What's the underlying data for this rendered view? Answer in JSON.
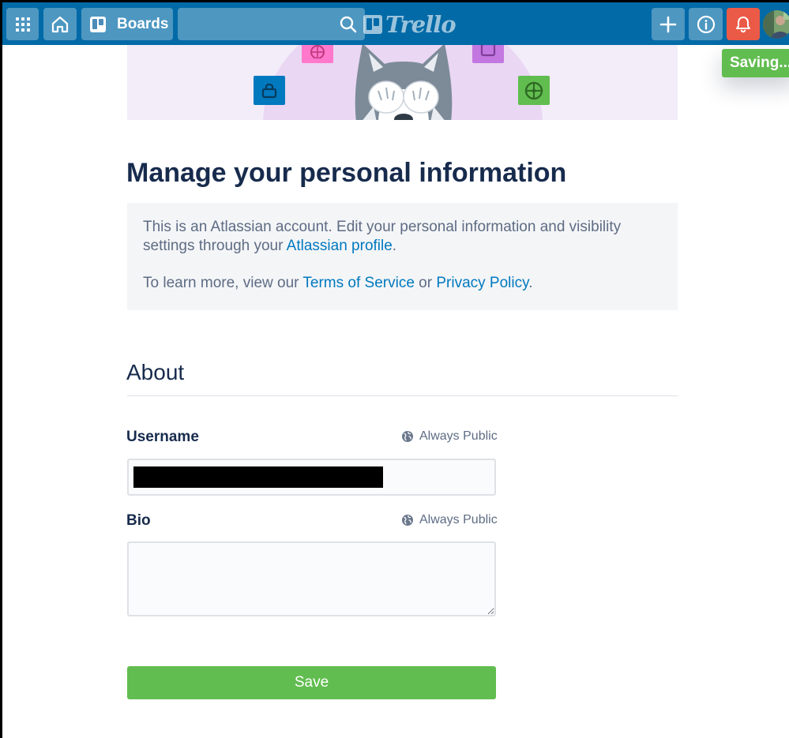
{
  "app": {
    "logo_text": "Trello"
  },
  "header": {
    "boards_label": "Boards",
    "search": {
      "value": "",
      "placeholder": ""
    },
    "icons": [
      "apps-icon",
      "home-icon",
      "board-icon",
      "search-icon",
      "plus-icon",
      "info-icon",
      "bell-icon"
    ],
    "colors": {
      "bar": "#026aa7",
      "bell": "#eb5a46"
    }
  },
  "toast": {
    "text": "Saving..."
  },
  "main": {
    "title": "Manage your personal information",
    "info": {
      "line1_prefix": "This is an Atlassian account. Edit your personal information and visibility settings through your ",
      "atlassian_profile_link": "Atlassian profile",
      "line1_suffix": ".",
      "line2_prefix": "To learn more, view our ",
      "terms_link": "Terms of Service",
      "or_text": " or ",
      "privacy_link": "Privacy Policy",
      "line2_suffix": "."
    },
    "about": {
      "title": "About",
      "username": {
        "label": "Username",
        "visibility": "Always Public",
        "value": ""
      },
      "bio": {
        "label": "Bio",
        "visibility": "Always Public",
        "value": ""
      },
      "save_label": "Save"
    }
  },
  "colors": {
    "accent_green": "#61bd4f",
    "link": "#0079bf",
    "text": "#172b4d"
  }
}
